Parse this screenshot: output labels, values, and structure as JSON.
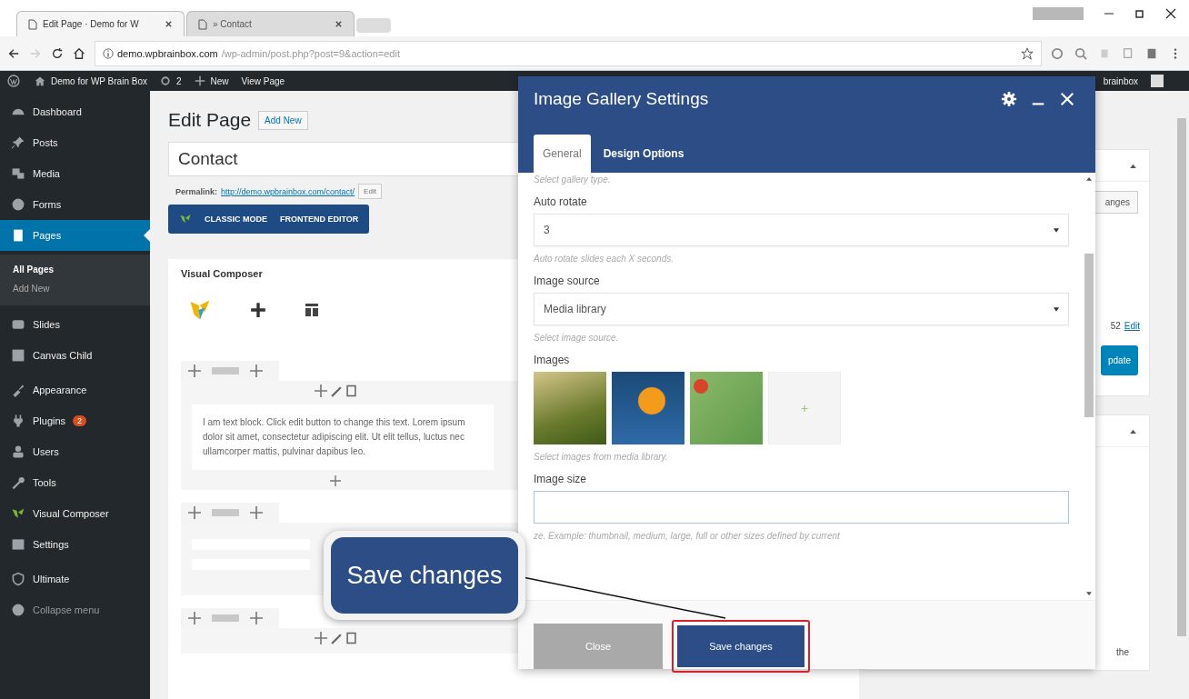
{
  "browser": {
    "tabs": [
      {
        "title": "Edit Page · Demo for W",
        "selected": true
      },
      {
        "title": "» Contact",
        "selected": false
      }
    ],
    "url_host": "demo.wpbrainbox.com",
    "url_path": "/wp-admin/post.php?post=9&action=edit"
  },
  "admin_bar": {
    "site": "Demo for WP Brain Box",
    "updates": "2",
    "new": "New",
    "view": "View Page",
    "user": "brainbox"
  },
  "sidebar": {
    "items": [
      {
        "label": "Dashboard",
        "selected": false
      },
      {
        "label": "Posts",
        "selected": false
      },
      {
        "label": "Media",
        "selected": false
      },
      {
        "label": "Forms",
        "selected": false
      },
      {
        "label": "Pages",
        "selected": true,
        "children": [
          {
            "label": "All Pages",
            "selected": true
          },
          {
            "label": "Add New",
            "selected": false
          }
        ]
      },
      {
        "label": "Slides",
        "selected": false
      },
      {
        "label": "Canvas Child",
        "selected": false
      },
      {
        "label": "Appearance",
        "selected": false
      },
      {
        "label": "Plugins",
        "selected": false,
        "badge": "2"
      },
      {
        "label": "Users",
        "selected": false
      },
      {
        "label": "Tools",
        "selected": false
      },
      {
        "label": "Visual Composer",
        "selected": false
      },
      {
        "label": "Settings",
        "selected": false
      },
      {
        "label": "Ultimate",
        "selected": false
      },
      {
        "label": "Collapse menu",
        "selected": false
      }
    ]
  },
  "editor": {
    "heading": "Edit Page",
    "add_new": "Add New",
    "title": "Contact",
    "permalink_label": "Permalink:",
    "permalink": "http://demo.wpbrainbox.com/contact/",
    "edit": "Edit",
    "modes": [
      "CLASSIC MODE",
      "FRONTEND EDITOR"
    ],
    "composer_title": "Visual Composer",
    "text_block": "I am text block. Click edit button to change this text. Lorem ipsum dolor sit amet, consectetur adipiscing elit. Ut elit tellus, luctus nec ullamcorper mattis, pulvinar dapibus leo."
  },
  "side_panels": {
    "button": "anges",
    "date_part": "52",
    "edit_link": "Edit",
    "update": "pdate",
    "note": "the"
  },
  "modal": {
    "title": "Image Gallery Settings",
    "tabs": [
      {
        "label": "General",
        "selected": true
      },
      {
        "label": "Design Options",
        "selected": false
      }
    ],
    "fields": [
      {
        "kind": "hint",
        "text": "Select gallery type."
      },
      {
        "kind": "select",
        "label": "Auto rotate",
        "value": "3",
        "hint": "Auto rotate slides each X seconds."
      },
      {
        "kind": "select",
        "label": "Image source",
        "value": "Media library",
        "hint": "Select image source."
      },
      {
        "kind": "images",
        "label": "Images",
        "add": "+",
        "hint": "Select images from media library."
      },
      {
        "kind": "text",
        "label": "Image size",
        "hint": "ze. Example: thumbnail, medium, large, full or other sizes defined by current"
      }
    ],
    "footer": {
      "close": "Close",
      "save": "Save changes",
      "save_highlighted": true
    }
  },
  "callout": {
    "text": "Save changes"
  }
}
